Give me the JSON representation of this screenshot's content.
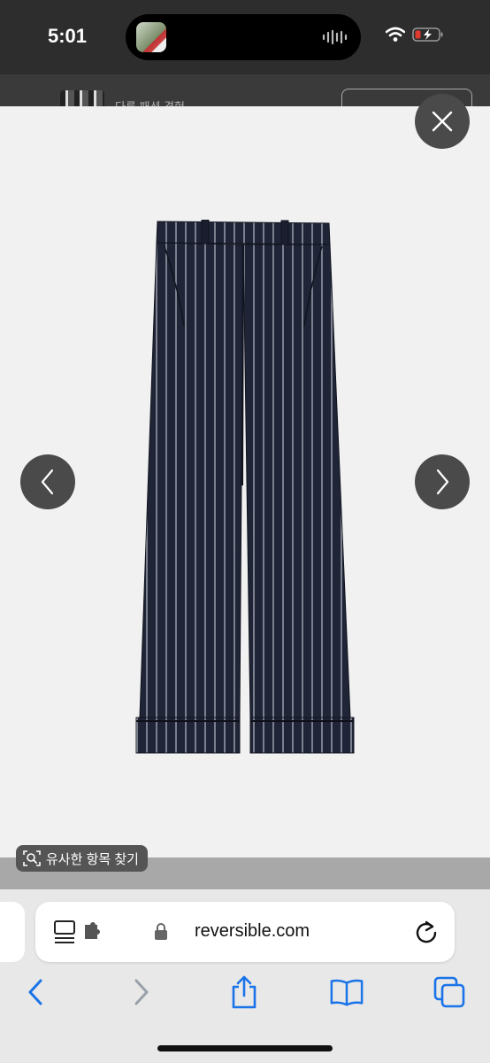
{
  "status_bar": {
    "time": "5:01",
    "icons": [
      "island-thumbnail-icon",
      "audio-wave-icon",
      "wifi-icon",
      "battery-charging-icon"
    ],
    "battery_color": "#e03a2f"
  },
  "page_header": {
    "text": "다른 패션 경험"
  },
  "viewer": {
    "image_description_icon": "striped-trousers-image",
    "close_icon": "close-icon",
    "prev_icon": "chevron-left-icon",
    "next_icon": "chevron-right-icon"
  },
  "visual_lookup": {
    "icon": "visual-search-icon",
    "label": "유사한 항목 찾기"
  },
  "browser": {
    "url": "reversible.com",
    "accent_color": "#1a73e8",
    "toolbar_icons": [
      "back-icon",
      "forward-icon",
      "share-icon",
      "bookmarks-icon",
      "tabs-icon"
    ]
  }
}
